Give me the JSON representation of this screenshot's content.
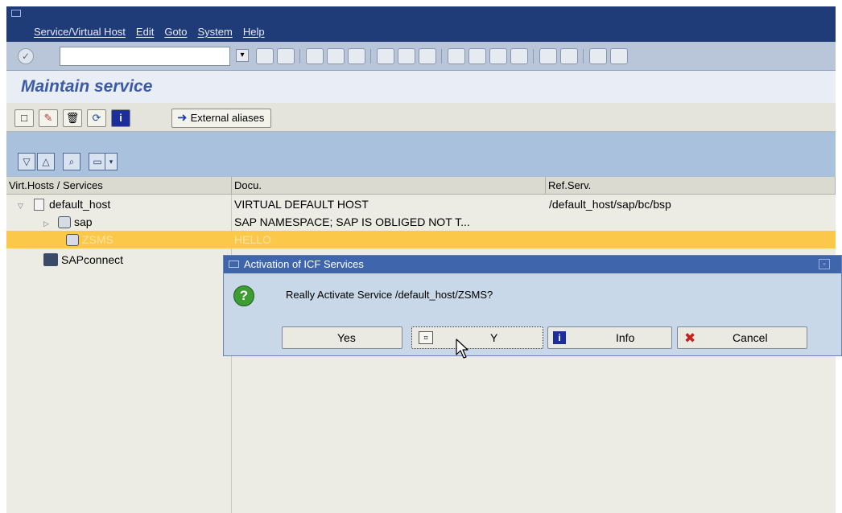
{
  "menu": [
    "Service/Virtual Host",
    "Edit",
    "Goto",
    "System",
    "Help"
  ],
  "page_title": "Maintain service",
  "app_toolbar": {
    "external_aliases_label": "External aliases"
  },
  "tree": {
    "headers": {
      "col1": "Virt.Hosts / Services",
      "col2": "Docu.",
      "col3": "Ref.Serv."
    },
    "rows": [
      {
        "name": "default_host",
        "docu": "VIRTUAL DEFAULT HOST",
        "ref": "/default_host/sap/bc/bsp"
      },
      {
        "name": "sap",
        "docu": "SAP NAMESPACE; SAP IS OBLIGED NOT T...",
        "ref": ""
      },
      {
        "name": "ZSMS",
        "docu": "HELLO",
        "ref": "",
        "highlighted": true
      },
      {
        "name": "SAPconnect",
        "docu": "",
        "ref": ""
      }
    ]
  },
  "dialog": {
    "title": "Activation of ICF Services",
    "message": "Really Activate Service /default_host/ZSMS?",
    "buttons": {
      "yes": "Yes",
      "y": "Y",
      "info": "Info",
      "cancel": "Cancel"
    }
  },
  "colors": {
    "menu_bar": "#1f3b78",
    "title_text": "#3b5ba5",
    "highlight_row": "#fbc84a",
    "dialog_title_bar": "#3f66ad"
  }
}
